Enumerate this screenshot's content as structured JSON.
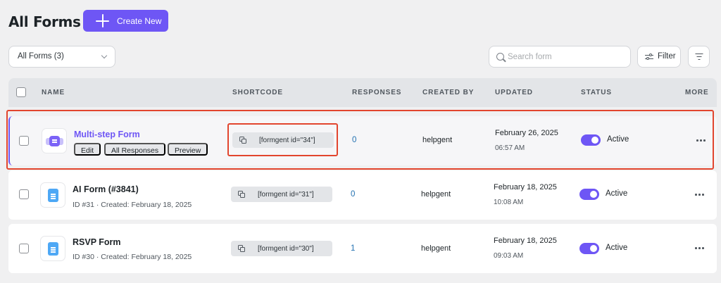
{
  "header": {
    "title": "All Forms",
    "create_label": "Create New"
  },
  "toolbar": {
    "select_value": "All Forms (3)",
    "search_placeholder": "Search form",
    "filter_label": "Filter"
  },
  "table": {
    "columns": [
      "NAME",
      "SHORTCODE",
      "RESPONSES",
      "CREATED BY",
      "UPDATED",
      "STATUS",
      "MORE"
    ],
    "rows": [
      {
        "name": "Multi-step Form",
        "actions": [
          "Edit",
          "All Responses",
          "Preview"
        ],
        "shortcode": "[formgent id=\"34\"]",
        "responses": "0",
        "created_by": "helpgent",
        "updated_date": "February 26, 2025",
        "updated_time": "06:57 AM",
        "status": "Active"
      },
      {
        "name": "AI Form (#3841)",
        "meta": "ID #31 · Created: February 18, 2025",
        "shortcode": "[formgent id=\"31\"]",
        "responses": "0",
        "created_by": "helpgent",
        "updated_date": "February 18, 2025",
        "updated_time": "10:08 AM",
        "status": "Active"
      },
      {
        "name": "RSVP Form",
        "meta": "ID #30 · Created: February 18, 2025",
        "shortcode": "[formgent id=\"30\"]",
        "responses": "1",
        "created_by": "helpgent",
        "updated_date": "February 18, 2025",
        "updated_time": "09:03 AM",
        "status": "Active"
      }
    ]
  },
  "icons": {
    "create": "plus-icon",
    "select": "chevron-down-icon",
    "search": "search-icon",
    "filter": "sliders-icon",
    "sort": "sort-icon",
    "copy": "copy-icon",
    "form": "document-icon",
    "multi_step_form": "multi-step-form-icon",
    "more": "ellipsis-icon"
  },
  "colors": {
    "accent": "#6e56f5",
    "highlight": "#e2452e",
    "link": "#2271b1",
    "form_icon": "#4ea8f5"
  }
}
